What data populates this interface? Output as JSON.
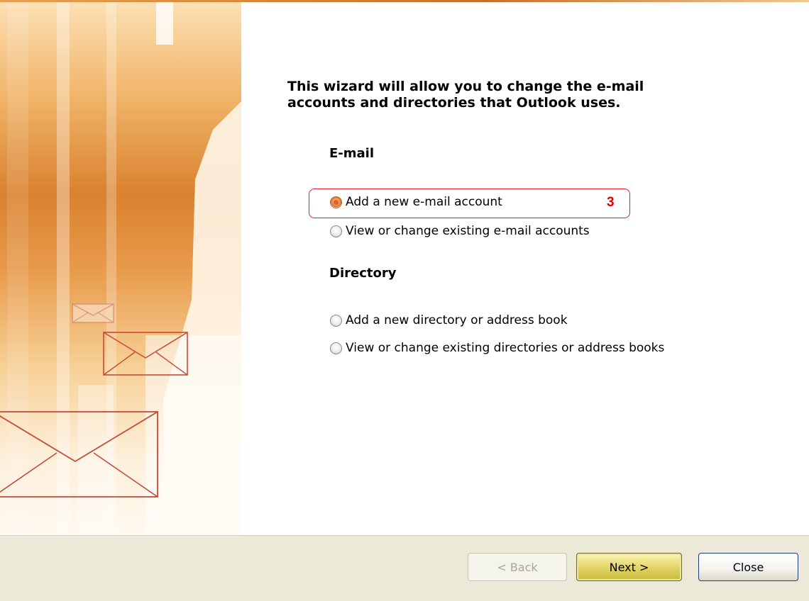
{
  "wizard": {
    "headline": "This wizard will allow you to change the e-mail\naccounts and directories that Outlook uses."
  },
  "email_section": {
    "title": "E-mail",
    "options": [
      {
        "label": "Add a new e-mail account",
        "checked": true
      },
      {
        "label": "View or change existing e-mail accounts",
        "checked": false
      }
    ]
  },
  "directory_section": {
    "title": "Directory",
    "options": [
      {
        "label": "Add a new directory or address book",
        "checked": false
      },
      {
        "label": "View or change existing directories or address books",
        "checked": false
      }
    ]
  },
  "annotation": {
    "step_number": "3",
    "color": "#e00000"
  },
  "buttons": {
    "back": "< Back",
    "next": "Next >",
    "close": "Close"
  },
  "icons": {
    "envelope": "envelope-icon",
    "radio_selected": "radio-selected-icon",
    "radio_empty": "radio-empty-icon"
  }
}
